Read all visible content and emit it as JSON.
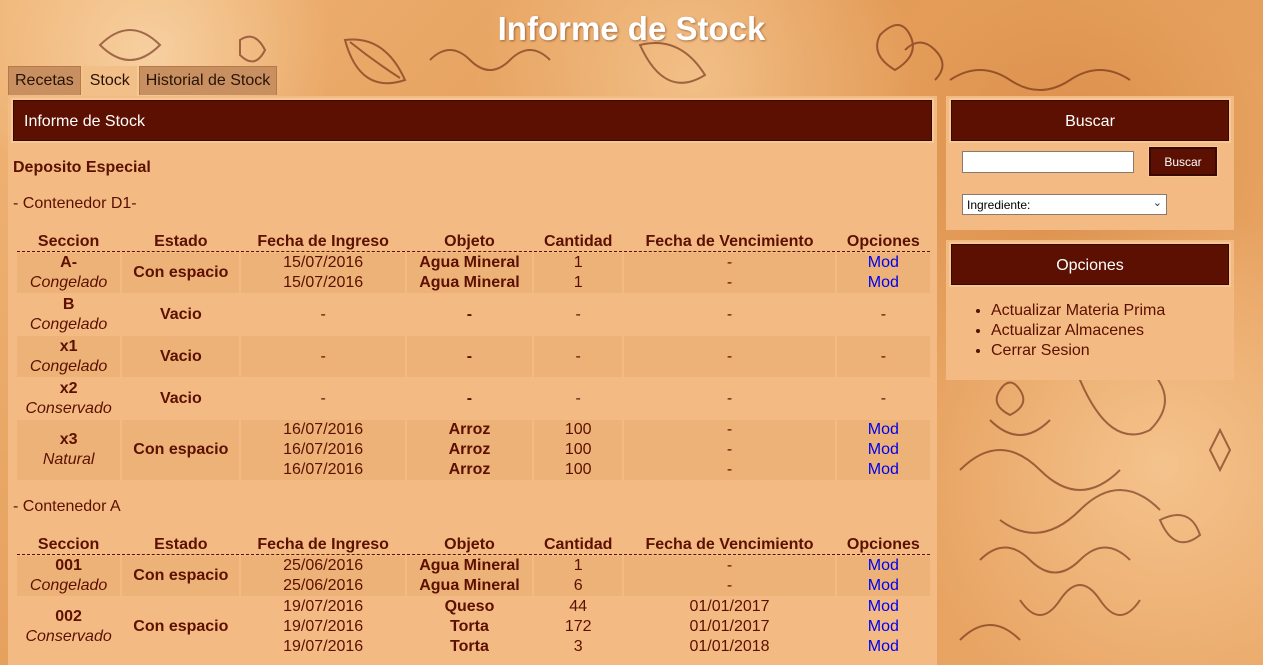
{
  "site_title": "Informe de Stock",
  "tabs": [
    {
      "label": "Recetas"
    },
    {
      "label": "Stock"
    },
    {
      "label": "Historial de Stock"
    }
  ],
  "main": {
    "header": "Informe de Stock",
    "depot": "Deposito Especial",
    "columns": [
      "Seccion",
      "Estado",
      "Fecha de Ingreso",
      "Objeto",
      "Cantidad",
      "Fecha de Vencimiento",
      "Opciones"
    ],
    "containers": [
      {
        "title": "- Contenedor D1-",
        "sections": [
          {
            "name": "A-",
            "type": "Congelado",
            "estado": "Con espacio",
            "items": [
              {
                "fecha": "15/07/2016",
                "objeto": "Agua Mineral",
                "cantidad": "1",
                "vence": "-",
                "opcion": "Mod"
              },
              {
                "fecha": "15/07/2016",
                "objeto": "Agua Mineral",
                "cantidad": "1",
                "vence": "-",
                "opcion": "Mod"
              }
            ]
          },
          {
            "name": "B",
            "type": "Congelado",
            "estado": "Vacio",
            "items": [
              {
                "fecha": "-",
                "objeto": "-",
                "cantidad": "-",
                "vence": "-",
                "opcion": "-"
              }
            ]
          },
          {
            "name": "x1",
            "type": "Congelado",
            "estado": "Vacio",
            "items": [
              {
                "fecha": "-",
                "objeto": "-",
                "cantidad": "-",
                "vence": "-",
                "opcion": "-"
              }
            ]
          },
          {
            "name": "x2",
            "type": "Conservado",
            "estado": "Vacio",
            "items": [
              {
                "fecha": "-",
                "objeto": "-",
                "cantidad": "-",
                "vence": "-",
                "opcion": "-"
              }
            ]
          },
          {
            "name": "x3",
            "type": "Natural",
            "estado": "Con espacio",
            "items": [
              {
                "fecha": "16/07/2016",
                "objeto": "Arroz",
                "cantidad": "100",
                "vence": "-",
                "opcion": "Mod"
              },
              {
                "fecha": "16/07/2016",
                "objeto": "Arroz",
                "cantidad": "100",
                "vence": "-",
                "opcion": "Mod"
              },
              {
                "fecha": "16/07/2016",
                "objeto": "Arroz",
                "cantidad": "100",
                "vence": "-",
                "opcion": "Mod"
              }
            ]
          }
        ]
      },
      {
        "title": "- Contenedor A",
        "sections": [
          {
            "name": "001",
            "type": "Congelado",
            "estado": "Con espacio",
            "items": [
              {
                "fecha": "25/06/2016",
                "objeto": "Agua Mineral",
                "cantidad": "1",
                "vence": "-",
                "opcion": "Mod"
              },
              {
                "fecha": "25/06/2016",
                "objeto": "Agua Mineral",
                "cantidad": "6",
                "vence": "-",
                "opcion": "Mod"
              }
            ]
          },
          {
            "name": "002",
            "type": "Conservado",
            "estado": "Con espacio",
            "items": [
              {
                "fecha": "19/07/2016",
                "objeto": "Queso",
                "cantidad": "44",
                "vence": "01/01/2017",
                "opcion": "Mod"
              },
              {
                "fecha": "19/07/2016",
                "objeto": "Torta",
                "cantidad": "172",
                "vence": "01/01/2017",
                "opcion": "Mod"
              },
              {
                "fecha": "19/07/2016",
                "objeto": "Torta",
                "cantidad": "3",
                "vence": "01/01/2018",
                "opcion": "Mod"
              }
            ]
          }
        ]
      }
    ]
  },
  "sidebar": {
    "search": {
      "header": "Buscar",
      "input_value": "",
      "button_label": "Buscar",
      "select_value": "Ingrediente:"
    },
    "options": {
      "header": "Opciones",
      "items": [
        "Actualizar Materia Prima",
        "Actualizar Almacenes",
        "Cerrar Sesion"
      ]
    }
  },
  "colors": {
    "bar": "#5c1001",
    "panel": "#f3bb83",
    "link": "#0000ee"
  }
}
